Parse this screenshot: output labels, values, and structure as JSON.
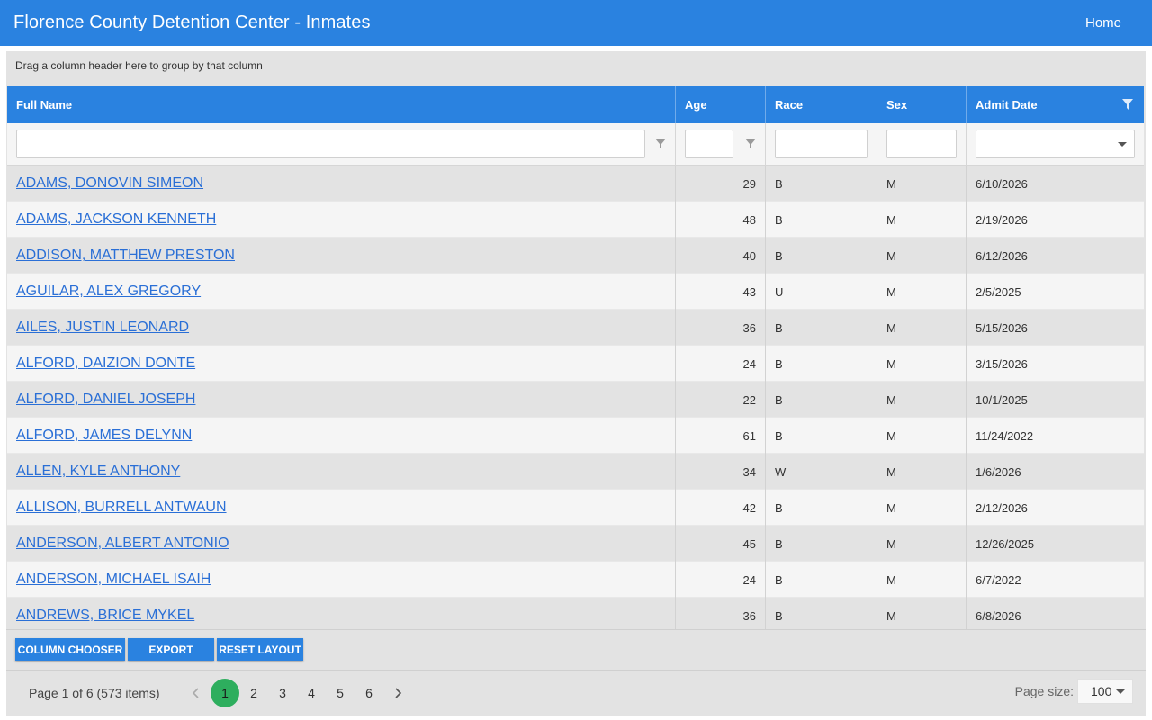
{
  "header": {
    "title": "Florence County Detention Center - Inmates",
    "home_label": "Home"
  },
  "grid": {
    "group_panel_text": "Drag a column header here to group by that column",
    "columns": [
      {
        "label": "Full Name"
      },
      {
        "label": "Age"
      },
      {
        "label": "Race"
      },
      {
        "label": "Sex"
      },
      {
        "label": "Admit Date"
      }
    ],
    "filters": {
      "name": "",
      "age": "",
      "race": "",
      "sex": "",
      "admit_date": ""
    },
    "rows": [
      {
        "name": "ADAMS, DONOVIN SIMEON",
        "age": "29",
        "race": "B",
        "sex": "M",
        "admit_date": "6/10/2026"
      },
      {
        "name": "ADAMS, JACKSON KENNETH",
        "age": "48",
        "race": "B",
        "sex": "M",
        "admit_date": "2/19/2026"
      },
      {
        "name": "ADDISON, MATTHEW PRESTON",
        "age": "40",
        "race": "B",
        "sex": "M",
        "admit_date": "6/12/2026"
      },
      {
        "name": "AGUILAR, ALEX GREGORY",
        "age": "43",
        "race": "U",
        "sex": "M",
        "admit_date": "2/5/2025"
      },
      {
        "name": "AILES, JUSTIN LEONARD",
        "age": "36",
        "race": "B",
        "sex": "M",
        "admit_date": "5/15/2026"
      },
      {
        "name": "ALFORD, DAIZION DONTE",
        "age": "24",
        "race": "B",
        "sex": "M",
        "admit_date": "3/15/2026"
      },
      {
        "name": "ALFORD, DANIEL JOSEPH",
        "age": "22",
        "race": "B",
        "sex": "M",
        "admit_date": "10/1/2025"
      },
      {
        "name": "ALFORD, JAMES DELYNN",
        "age": "61",
        "race": "B",
        "sex": "M",
        "admit_date": "11/24/2022"
      },
      {
        "name": "ALLEN, KYLE ANTHONY",
        "age": "34",
        "race": "W",
        "sex": "M",
        "admit_date": "1/6/2026"
      },
      {
        "name": "ALLISON, BURRELL ANTWAUN",
        "age": "42",
        "race": "B",
        "sex": "M",
        "admit_date": "2/12/2026"
      },
      {
        "name": "ANDERSON, ALBERT ANTONIO",
        "age": "45",
        "race": "B",
        "sex": "M",
        "admit_date": "12/26/2025"
      },
      {
        "name": "ANDERSON, MICHAEL ISAIH",
        "age": "24",
        "race": "B",
        "sex": "M",
        "admit_date": "6/7/2022"
      },
      {
        "name": "ANDREWS, BRICE MYKEL",
        "age": "36",
        "race": "B",
        "sex": "M",
        "admit_date": "6/8/2026"
      }
    ]
  },
  "toolbar": {
    "column_chooser": "COLUMN CHOOSER",
    "export": "EXPORT",
    "reset_layout": "RESET LAYOUT"
  },
  "pager": {
    "info": "Page 1 of 6 (573 items)",
    "pages": [
      "1",
      "2",
      "3",
      "4",
      "5",
      "6"
    ],
    "current_page": "1",
    "page_size_label": "Page size:",
    "page_size": "100"
  },
  "colors": {
    "accent": "#2a82e0",
    "active_page": "#2eae5e",
    "link": "#2a6fd6"
  },
  "icons": {
    "filter": "funnel-icon",
    "dropdown": "chevron-down-icon",
    "prev": "chevron-left-icon",
    "next": "chevron-right-icon"
  }
}
